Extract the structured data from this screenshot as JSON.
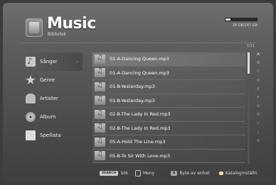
{
  "header": {
    "title": "Music",
    "subtitle": "Bibliotek",
    "storage_text": "38 GB/247 GB",
    "storage_fraction": 0.15
  },
  "sidebar": {
    "items": [
      {
        "label": "Sånger",
        "icon": "music-note-icon",
        "active": true
      },
      {
        "label": "Genre",
        "icon": "star-icon",
        "active": false
      },
      {
        "label": "Artister",
        "icon": "artist-icon",
        "active": false
      },
      {
        "label": "Album",
        "icon": "disc-icon",
        "active": false
      },
      {
        "label": "Spellista",
        "icon": "playlist-icon",
        "active": false
      }
    ]
  },
  "list": {
    "page": "1/11",
    "rows": [
      {
        "label": "01-A-Dancing Queen.mp3"
      },
      {
        "label": "01-A-Dancing Queen.mp3"
      },
      {
        "label": "01-B-Yesterday.mp3"
      },
      {
        "label": "01-B-Yesterday.mp3"
      },
      {
        "label": "02-B-The Lady In Red.mp3"
      },
      {
        "label": "02-B-The Lady In Red.mp3"
      },
      {
        "label": "05-A-Hold The Line.mp3"
      },
      {
        "label": "05-B-To Sir With Love.mp3"
      }
    ],
    "alphabet": [
      "A",
      "B",
      "C",
      "D",
      "E",
      "F",
      "G",
      "H",
      "I",
      "J",
      "K"
    ]
  },
  "footer": {
    "search_key": "SEARCH",
    "search_label": "Sök",
    "menu_label": "Meny",
    "device_key": "B",
    "device_label": "Byte av enhet",
    "catalog_label": "Kataloginställn."
  }
}
